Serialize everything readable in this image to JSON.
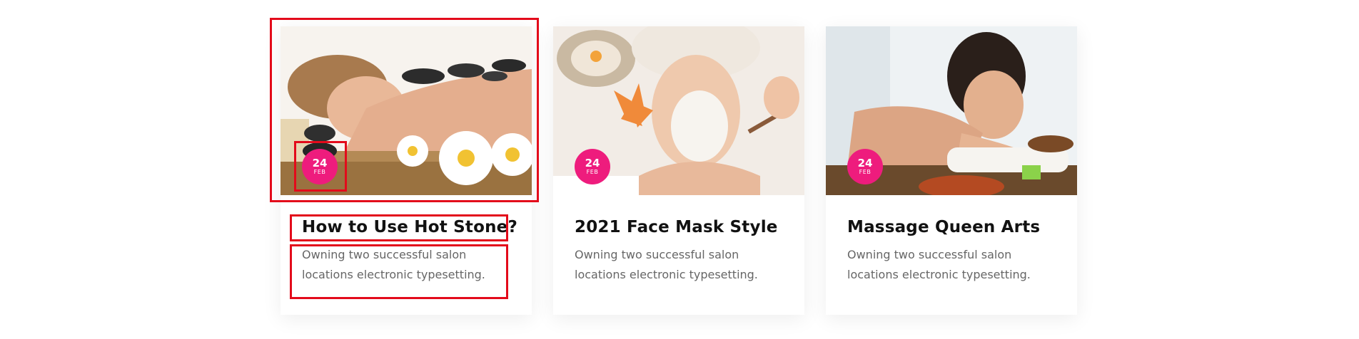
{
  "posts": [
    {
      "date": {
        "day": "24",
        "month": "FEB"
      },
      "title": "How to Use Hot Stone?",
      "excerpt": "Owning two successful salon locations electronic typesetting.",
      "image": "hot-stone-massage-photo"
    },
    {
      "date": {
        "day": "24",
        "month": "FEB"
      },
      "title": "2021 Face Mask Style",
      "excerpt": "Owning two successful salon locations electronic typesetting.",
      "image": "face-mask-spa-photo"
    },
    {
      "date": {
        "day": "24",
        "month": "FEB"
      },
      "title": "Massage Queen Arts",
      "excerpt": "Owning two successful salon locations electronic typesetting.",
      "image": "relaxing-massage-photo"
    }
  ],
  "colors": {
    "accent": "#ee1c7d",
    "highlight": "#e30b1b",
    "title": "#111111",
    "text": "#666666"
  }
}
